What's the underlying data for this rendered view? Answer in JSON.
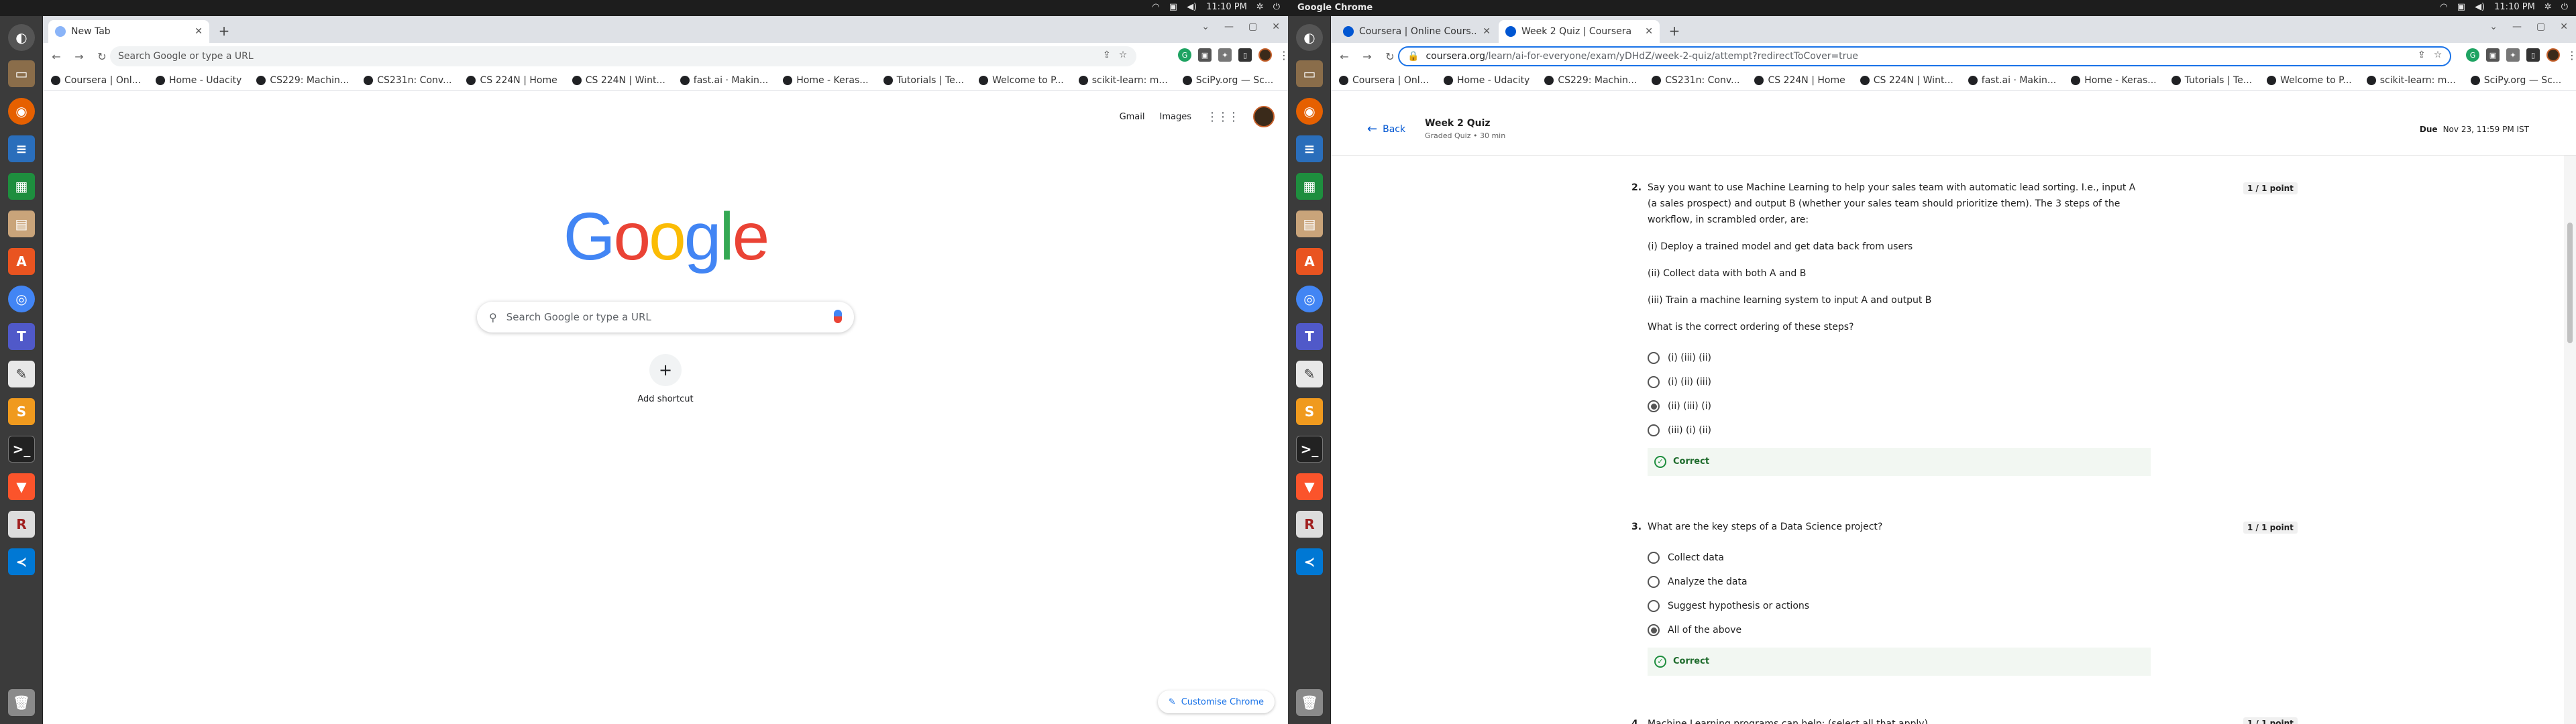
{
  "system": {
    "app_name": "Google Chrome",
    "time": "11:10 PM"
  },
  "left": {
    "tabs": [
      {
        "title": "New Tab",
        "active": true
      }
    ],
    "omnibox_placeholder": "Search Google or type a URL",
    "bookmarks": [
      "Coursera | Onl...",
      "Home - Udacity",
      "CS229: Machin...",
      "CS231n: Conv...",
      "CS 224N | Home",
      "CS 224N | Wint...",
      "fast.ai · Makin...",
      "Home - Keras...",
      "Tutorials | Te...",
      "Welcome to P...",
      "scikit-learn: m...",
      "SciPy.org — Sc..."
    ],
    "ntp": {
      "gmail": "Gmail",
      "images": "Images",
      "logo": [
        "G",
        "o",
        "o",
        "g",
        "l",
        "e"
      ],
      "search_placeholder": "Search Google or type a URL",
      "add_shortcut": "Add shortcut",
      "customise": "Customise Chrome"
    }
  },
  "right": {
    "tabs": [
      {
        "title": "Coursera | Online Cours..."
      },
      {
        "title": "Week 2 Quiz | Coursera",
        "active": true
      }
    ],
    "url_host": "coursera.org",
    "url_path": "/learn/ai-for-everyone/exam/yDHdZ/week-2-quiz/attempt?redirectToCover=true",
    "bookmarks": [
      "Coursera | Onl...",
      "Home - Udacity",
      "CS229: Machin...",
      "CS231n: Conv...",
      "CS 224N | Home",
      "CS 224N | Wint...",
      "fast.ai · Makin...",
      "Home - Keras...",
      "Tutorials | Te...",
      "Welcome to P...",
      "scikit-learn: m...",
      "SciPy.org — Sc..."
    ],
    "quiz": {
      "back": "Back",
      "title": "Week 2 Quiz",
      "subtitle": "Graded Quiz • 30 min",
      "due_label": "Due",
      "due_value": "Nov 23, 11:59 PM IST",
      "q2": {
        "number": "2.",
        "text": "Say you want to use Machine Learning to help your sales team with automatic lead sorting. I.e., input A (a sales prospect) and output B (whether your sales team should prioritize them). The 3 steps of the workflow, in scrambled order, are:",
        "step1": "(i) Deploy a trained model and get data back from users",
        "step2": "(ii) Collect data with both A and B",
        "step3": "(iii) Train a machine learning system to input A and output B",
        "prompt": "What is the correct ordering of these steps?",
        "options": [
          "(i) (iii) (ii)",
          "(i) (ii) (iii)",
          "(ii) (iii) (i)",
          "(iii) (i) (ii)"
        ],
        "selected": 2,
        "points": "1 / 1 point",
        "feedback": "Correct"
      },
      "q3": {
        "number": "3.",
        "text": "What are the key steps of a Data Science project?",
        "options": [
          "Collect data",
          "Analyze the data",
          "Suggest hypothesis or actions",
          "All of the above"
        ],
        "selected": 3,
        "points": "1 / 1 point",
        "feedback": "Correct"
      },
      "q4": {
        "number": "4.",
        "text": "Machine Learning programs can help: (select all that apply)",
        "points": "1 / 1 point"
      }
    }
  }
}
